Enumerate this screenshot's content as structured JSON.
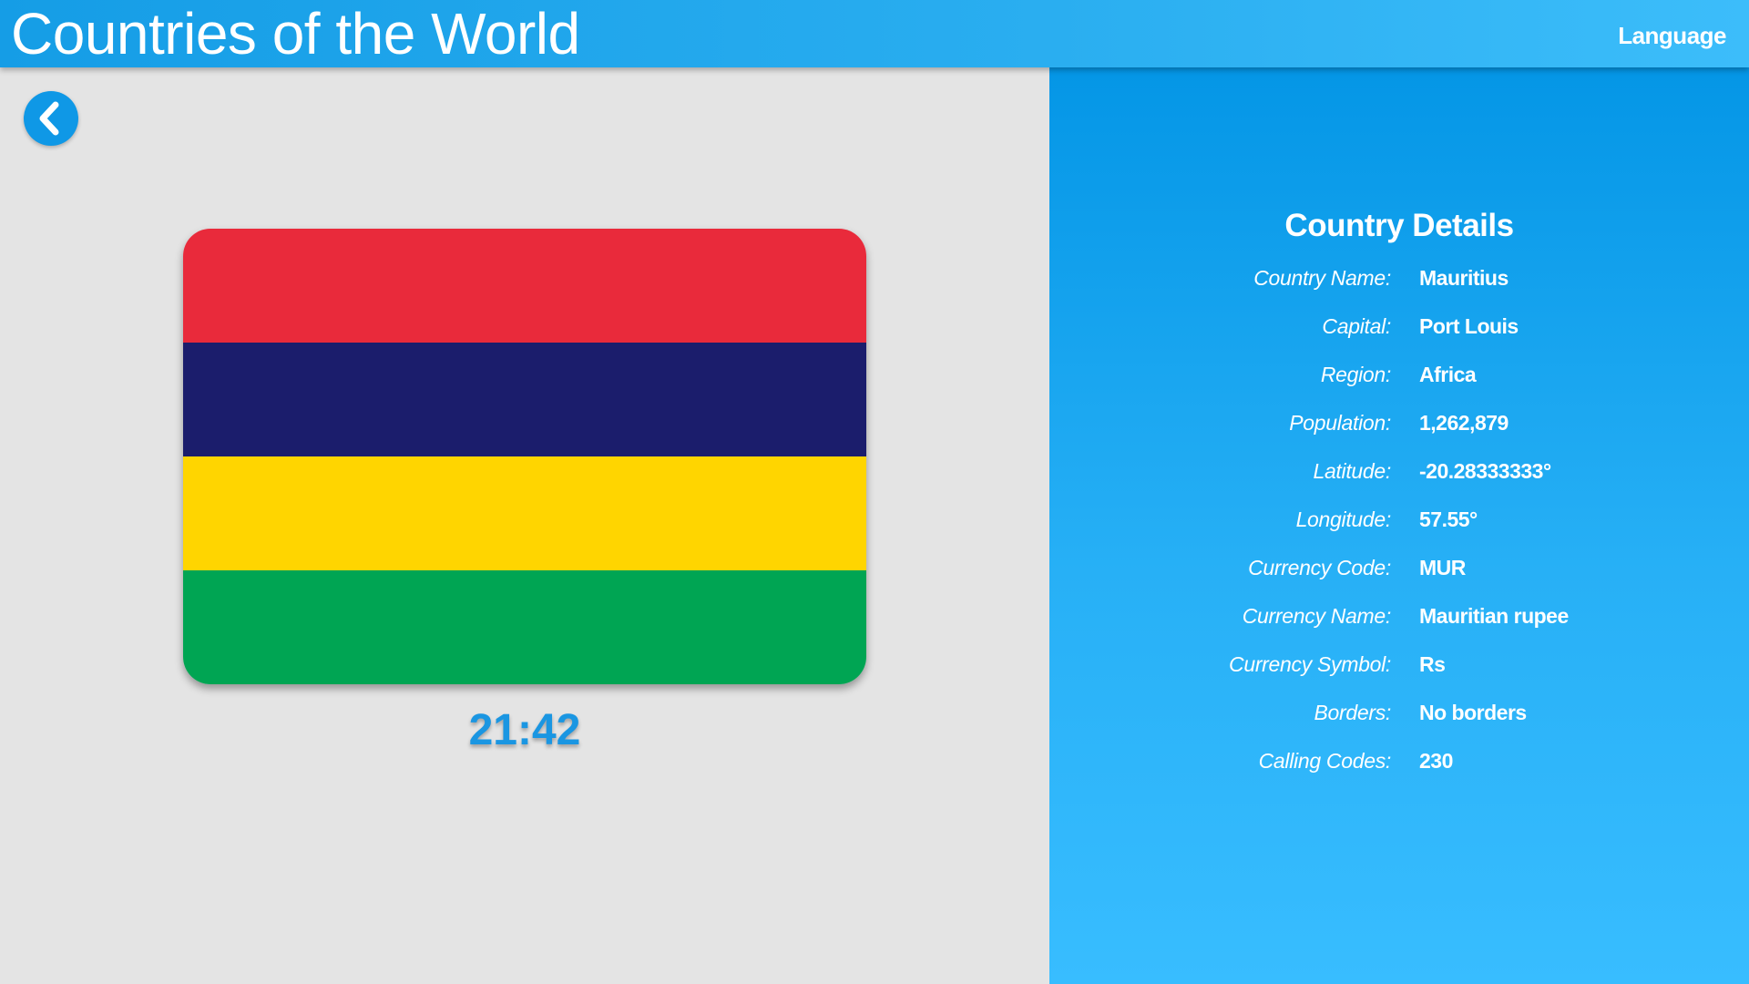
{
  "header": {
    "title": "Countries of the World",
    "language_label": "Language",
    "accent": "#159de6"
  },
  "back_button": {
    "icon": "chevron-left-icon",
    "color": "#0f98e6"
  },
  "flag": {
    "country": "Mauritius",
    "stripes": [
      "#e92a3b",
      "#1b1d6c",
      "#ffd500",
      "#00a553"
    ]
  },
  "clock": "21:42",
  "details": {
    "title": "Country Details",
    "rows": [
      {
        "label": "Country Name:",
        "value": "Mauritius"
      },
      {
        "label": "Capital:",
        "value": "Port Louis"
      },
      {
        "label": "Region:",
        "value": "Africa"
      },
      {
        "label": "Population:",
        "value": "1,262,879"
      },
      {
        "label": "Latitude:",
        "value": "-20.28333333°"
      },
      {
        "label": "Longitude:",
        "value": "57.55°"
      },
      {
        "label": "Currency Code:",
        "value": "MUR"
      },
      {
        "label": "Currency Name:",
        "value": "Mauritian rupee"
      },
      {
        "label": "Currency Symbol:",
        "value": "Rs"
      },
      {
        "label": "Borders:",
        "value": "No borders"
      },
      {
        "label": "Calling Codes:",
        "value": "230"
      }
    ]
  }
}
